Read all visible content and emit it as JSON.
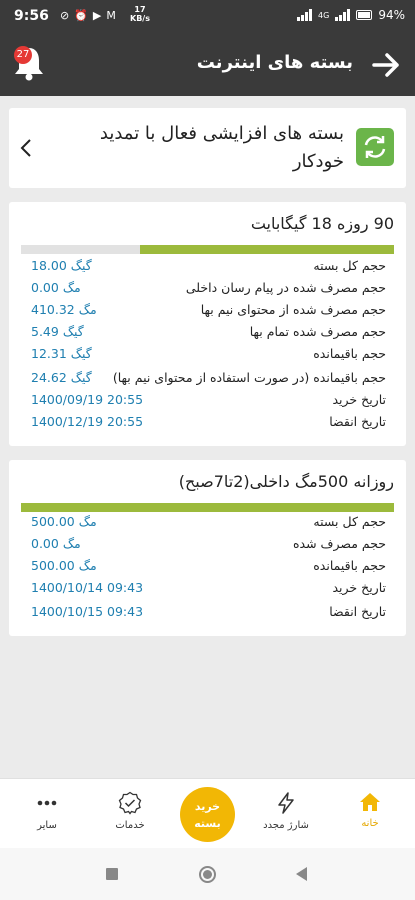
{
  "status_bar": {
    "time": "9:56",
    "speed_value": "17",
    "speed_unit": "KB/s",
    "network": "4G",
    "battery": "94%"
  },
  "app_bar": {
    "title": "بسته های اینترنت",
    "notification_count": "27"
  },
  "active_header": {
    "text": "بسته های افزایشی فعال با تمدید خودکار"
  },
  "packages": [
    {
      "title": "90 روزه 18 گیگابایت",
      "usage_fraction": 0.68,
      "rows": [
        {
          "label": "حجم کل بسته",
          "value": "18.00",
          "unit": "گیگ"
        },
        {
          "label": "حجم مصرف شده در پیام رسان داخلی",
          "value": "0.00",
          "unit": "مگ"
        },
        {
          "label": "حجم مصرف شده از محتوای نیم بها",
          "value": "410.32",
          "unit": "مگ"
        },
        {
          "label": "حجم مصرف شده تمام بها",
          "value": "5.49",
          "unit": "گیگ"
        },
        {
          "label": "حجم باقیمانده",
          "value": "12.31",
          "unit": "گیگ"
        },
        {
          "label": "حجم باقیمانده (در صورت استفاده از محتوای نیم بها)",
          "value": "24.62",
          "unit": "گیگ"
        },
        {
          "label": "تاریخ خرید",
          "value": "1400/09/19 20:55",
          "unit": ""
        },
        {
          "label": "تاریخ انقضا",
          "value": "1400/12/19 20:55",
          "unit": ""
        }
      ]
    },
    {
      "title": "روزانه 500مگ داخلی(2تا7صبح)",
      "usage_fraction": 1.0,
      "rows": [
        {
          "label": "حجم کل بسته",
          "value": "500.00",
          "unit": "مگ"
        },
        {
          "label": "حجم مصرف شده",
          "value": "0.00",
          "unit": "مگ"
        },
        {
          "label": "حجم باقیمانده",
          "value": "500.00",
          "unit": "مگ"
        },
        {
          "label": "تاریخ خرید",
          "value": "1400/10/14 09:43",
          "unit": ""
        },
        {
          "label": "تاریخ انقضا",
          "value": "1400/10/15 09:43",
          "unit": ""
        }
      ]
    }
  ],
  "bottom_nav": {
    "home": "خانه",
    "recharge": "شارژ مجدد",
    "buy_line1": "خرید",
    "buy_line2": "بسته",
    "services": "خدمات",
    "more": "سایر"
  },
  "colors": {
    "accent": "#f2b705",
    "progress": "#9cba3c",
    "value_text": "#1f7fb0",
    "header_bg": "#3a3a3a",
    "app_icon": "#6bb54a"
  }
}
